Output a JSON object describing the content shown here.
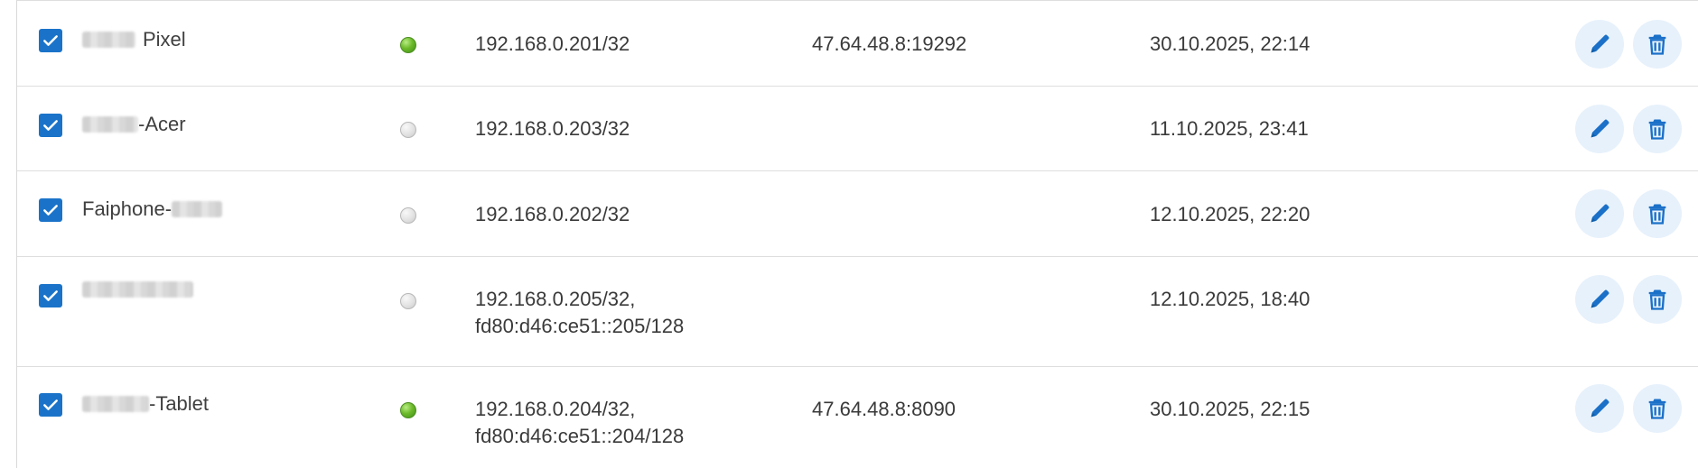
{
  "rows": [
    {
      "checked": true,
      "name_suffix": "Pixel",
      "status": "online",
      "ips": [
        "192.168.0.201/32"
      ],
      "endpoint": "47.64.48.8:19292",
      "last_seen": "30.10.2025, 22:14"
    },
    {
      "checked": true,
      "name_suffix": "-Acer",
      "status": "offline",
      "ips": [
        "192.168.0.203/32"
      ],
      "endpoint": "",
      "last_seen": "11.10.2025, 23:41"
    },
    {
      "checked": true,
      "name_prefix": "Faiphone-",
      "status": "offline",
      "ips": [
        "192.168.0.202/32"
      ],
      "endpoint": "",
      "last_seen": "12.10.2025, 22:20"
    },
    {
      "checked": true,
      "status": "offline",
      "ips": [
        "192.168.0.205/32,",
        "fd80:d46:ce51::205/128"
      ],
      "endpoint": "",
      "last_seen": "12.10.2025, 18:40"
    },
    {
      "checked": true,
      "name_suffix": "-Tablet",
      "status": "online",
      "ips": [
        "192.168.0.204/32,",
        "fd80:d46:ce51::204/128"
      ],
      "endpoint": "47.64.48.8:8090",
      "last_seen": "30.10.2025, 22:15"
    }
  ],
  "colors": {
    "accent": "#1a73c9",
    "online": "#6dbb2b",
    "offline": "#d6d6d6",
    "action_bg": "#e7f1fb"
  },
  "icons": {
    "edit": "pencil-icon",
    "delete": "trash-icon"
  }
}
